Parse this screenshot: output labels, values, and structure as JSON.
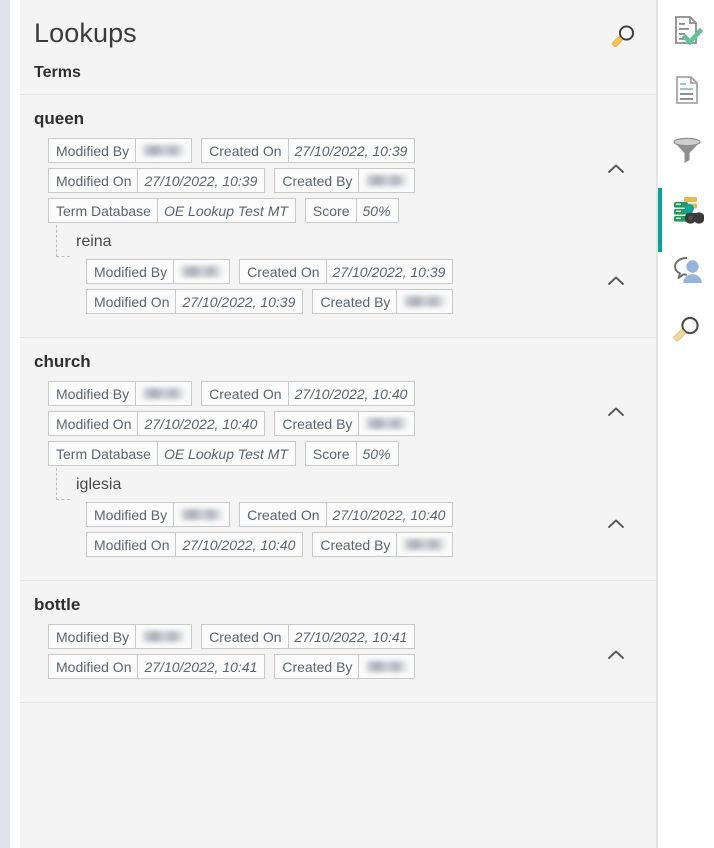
{
  "panel": {
    "title": "Lookups",
    "search_icon": "search-icon",
    "section_label": "Terms",
    "collapse_icon": "chevron-up-icon",
    "redacted_value": ""
  },
  "labels": {
    "modified_by": "Modified By",
    "created_on": "Created On",
    "modified_on": "Modified On",
    "created_by": "Created By",
    "term_database": "Term Database",
    "score": "Score"
  },
  "terms": [
    {
      "name": "queen",
      "modified_by": "",
      "created_on": "27/10/2022, 10:39",
      "modified_on": "27/10/2022, 10:39",
      "created_by": "",
      "term_database": "OE Lookup Test MT",
      "score": "50%",
      "child": {
        "name": "reina",
        "modified_by": "",
        "created_on": "27/10/2022, 10:39",
        "modified_on": "27/10/2022, 10:39",
        "created_by": ""
      }
    },
    {
      "name": "church",
      "modified_by": "",
      "created_on": "27/10/2022, 10:40",
      "modified_on": "27/10/2022, 10:40",
      "created_by": "",
      "term_database": "OE Lookup Test MT",
      "score": "50%",
      "child": {
        "name": "iglesia",
        "modified_by": "",
        "created_on": "27/10/2022, 10:40",
        "modified_on": "27/10/2022, 10:40",
        "created_by": ""
      }
    },
    {
      "name": "bottle",
      "modified_by": "",
      "created_on": "27/10/2022, 10:41",
      "modified_on": "27/10/2022, 10:41",
      "created_by": "",
      "term_database": "",
      "score": ""
    }
  ],
  "rail": {
    "items": [
      {
        "icon": "document-check-icon",
        "active": false,
        "badge": false
      },
      {
        "icon": "document-text-icon",
        "active": false,
        "badge": false
      },
      {
        "icon": "filter-funnel-icon",
        "active": false,
        "badge": false
      },
      {
        "icon": "terminology-lookup-icon",
        "active": true,
        "badge": true
      },
      {
        "icon": "comment-user-icon",
        "active": false,
        "badge": false
      },
      {
        "icon": "search-magnifier-icon",
        "active": false,
        "badge": false
      }
    ]
  },
  "colors": {
    "accent_teal": "#00a29a",
    "panel_bg": "#f4f4f4",
    "chip_text": "#5b6670",
    "edge_strip": "#dfe3ea"
  }
}
